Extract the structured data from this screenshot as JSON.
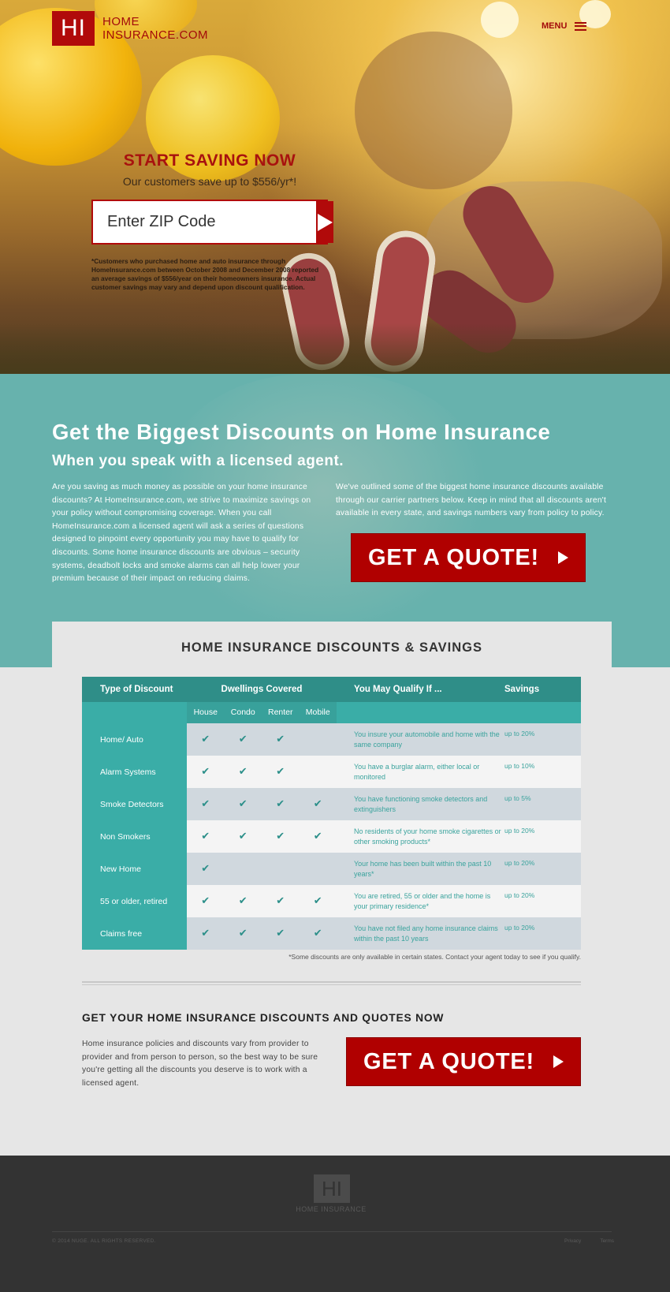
{
  "header": {
    "logo_mark": "HI",
    "logo_line1": "HOME",
    "logo_line2": "INSURANCE.COM",
    "menu_label": "MENU"
  },
  "hero": {
    "title": "START SAVING NOW",
    "subtitle": "Our customers save up to $556/yr*!",
    "zip_placeholder": "Enter ZIP Code",
    "disclaimer": "*Customers who purchased home and auto insurance through HomeInsurance.com between October 2008 and December 2008 reported an average savings of $556/year on their homeowners insurance. Actual customer savings may vary and depend upon discount qualification."
  },
  "discounts_intro": {
    "heading": "Get the Biggest Discounts on Home Insurance",
    "subheading": "When you speak with a licensed agent.",
    "paragraph_left": "Are you saving as much money as possible on your home insurance discounts? At HomeInsurance.com, we strive to maximize savings on your policy without compromising coverage. When you call HomeInsurance.com a licensed agent will ask a series of questions designed to pinpoint every opportunity you may have to qualify for discounts. Some home insurance discounts are obvious – security systems, deadbolt locks and smoke alarms can all help lower your premium because of their impact on reducing claims.",
    "paragraph_right": "We've outlined some of the biggest home insurance discounts available through our carrier partners below. Keep in mind that all discounts aren't available in every state, and savings numbers vary from policy to policy.",
    "cta_label": "GET A QUOTE!"
  },
  "table": {
    "title": "HOME INSURANCE DISCOUNTS & SAVINGS",
    "headers": {
      "type": "Type of Discount",
      "dwellings": "Dwellings Covered",
      "qualify": "You May Qualify If ...",
      "savings": "Savings"
    },
    "dwelling_types": [
      "House",
      "Condo",
      "Renter",
      "Mobile"
    ],
    "check_glyph": "✔",
    "rows": [
      {
        "type": "Home/ Auto",
        "checks": [
          "✔",
          "✔",
          "✔",
          ""
        ],
        "qualify": "You insure your automobile and home with the same company",
        "savings": "up to 20%"
      },
      {
        "type": "Alarm Systems",
        "checks": [
          "✔",
          "✔",
          "✔",
          ""
        ],
        "qualify": "You have a burglar alarm, either local or monitored",
        "savings": "up to 10%"
      },
      {
        "type": "Smoke Detectors",
        "checks": [
          "✔",
          "✔",
          "✔",
          "✔"
        ],
        "qualify": "You have functioning smoke detectors and extinguishers",
        "savings": "up to 5%"
      },
      {
        "type": "Non Smokers",
        "checks": [
          "✔",
          "✔",
          "✔",
          "✔"
        ],
        "qualify": "No residents of your home smoke cigarettes or other smoking products*",
        "savings": "up to 20%"
      },
      {
        "type": "New Home",
        "checks": [
          "✔",
          "",
          "",
          ""
        ],
        "qualify": "Your home has been built within the past 10 years*",
        "savings": "up to 20%"
      },
      {
        "type": "55 or older, retired",
        "checks": [
          "✔",
          "✔",
          "✔",
          "✔"
        ],
        "qualify": "You are retired, 55 or older and the home is your primary residence*",
        "savings": "up to 20%"
      },
      {
        "type": "Claims free",
        "checks": [
          "✔",
          "✔",
          "✔",
          "✔"
        ],
        "qualify": "You have not filed any home insurance claims within the past 10 years",
        "savings": "up to 20%"
      }
    ],
    "note": "*Some discounts are only available in certain states. Contact your agent today to see if you qualify."
  },
  "bottom": {
    "heading": "GET YOUR HOME INSURANCE DISCOUNTS AND QUOTES NOW",
    "paragraph": "Home insurance policies and discounts vary from provider to provider and from person to person, so the best way to be sure you're getting all the discounts you deserve is to work with a licensed agent.",
    "cta_label": "GET A QUOTE!"
  },
  "footer": {
    "logo_mark": "HI",
    "logo_text": "HOME INSURANCE",
    "copyright": "© 2014 NUGE. ALL RIGHTS RESERVED.",
    "links": [
      "Privacy",
      "Terms"
    ]
  },
  "colors": {
    "brand_red": "#b10a0a",
    "teal": "#67b2ad",
    "teal_dark": "#2f8e88",
    "footer_bg": "#333333"
  }
}
